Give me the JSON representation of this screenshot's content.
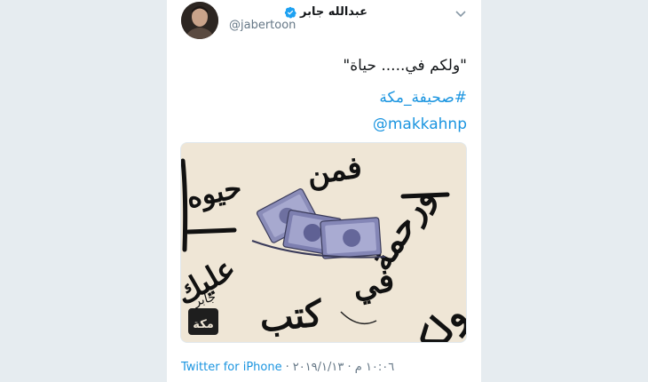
{
  "tweet": {
    "display_name": "عبدالله جابر",
    "handle": "@jabertoon",
    "verified_icon": "verified-badge-icon",
    "menu_icon": "chevron-down-icon",
    "text": "\"ولكم في..... حياة\"",
    "hashtag": "#صحيفة_مكة",
    "mention": "@makkahnp",
    "media": {
      "calligraphy": [
        "فمن",
        "ورحمة",
        "حيوه",
        "عليك",
        "كتب",
        "ولكم",
        "في"
      ],
      "corner_logo": "مكة",
      "signature": "جابر"
    },
    "source": "Twitter for iPhone",
    "separator": "·",
    "timestamp": "١٠:٠٦ م · ٢٠١٩/١/١٣"
  },
  "colors": {
    "link": "#1b95e0",
    "text": "#14171a",
    "muted": "#657786",
    "background": "#e6ecf0",
    "cartoon_bg": "#efe6d6",
    "money": "#7d7fb0"
  }
}
